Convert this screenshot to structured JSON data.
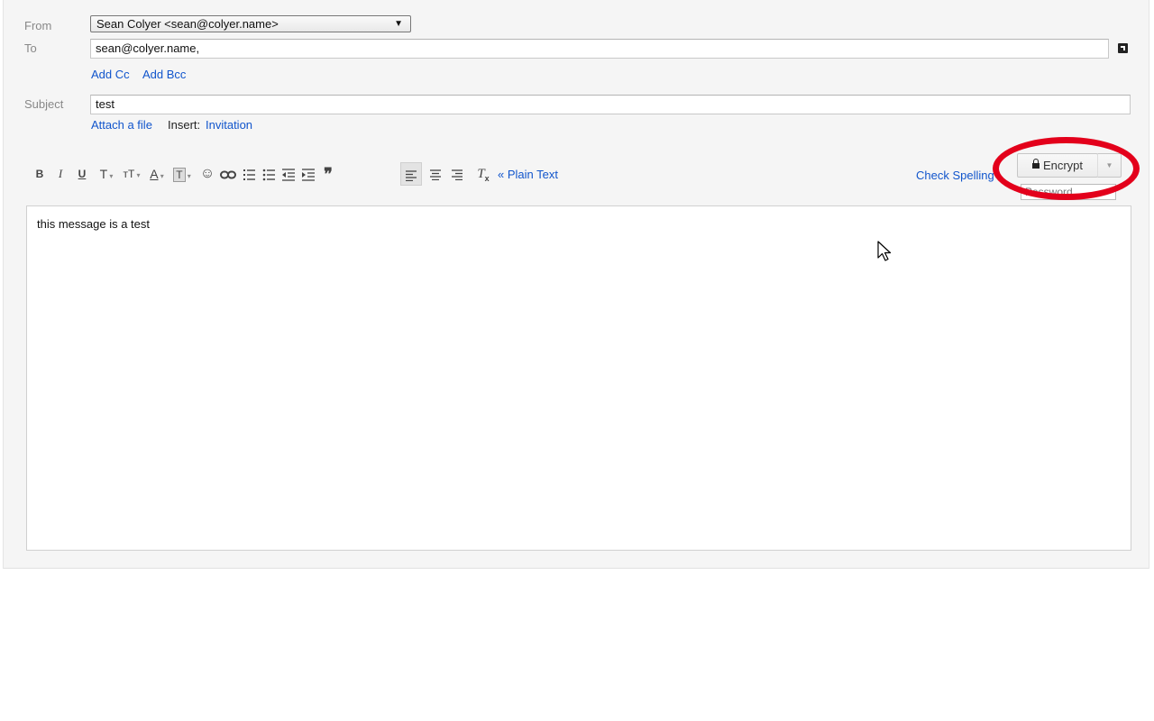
{
  "compose": {
    "from_label": "From",
    "from_value": "Sean Colyer <sean@colyer.name>",
    "to_label": "To",
    "to_value": "sean@colyer.name,",
    "add_cc": "Add Cc",
    "add_bcc": "Add Bcc",
    "subject_label": "Subject",
    "subject_value": "test",
    "attach_file": "Attach a file",
    "insert_label": "Insert:",
    "invitation": "Invitation"
  },
  "toolbar": {
    "bold": "B",
    "italic": "I",
    "underline": "U",
    "font": "T",
    "size": "тT",
    "text_color": "A",
    "highlight": "T",
    "plain_text": "« Plain Text",
    "check_spelling": "Check Spelling"
  },
  "encrypt": {
    "button_label": "Encrypt",
    "password_placeholder": "Password",
    "highlight_color": "#e3001b"
  },
  "body": {
    "text": "this message is a test"
  },
  "colors": {
    "link": "#1155cc",
    "panel": "#f5f5f5"
  }
}
